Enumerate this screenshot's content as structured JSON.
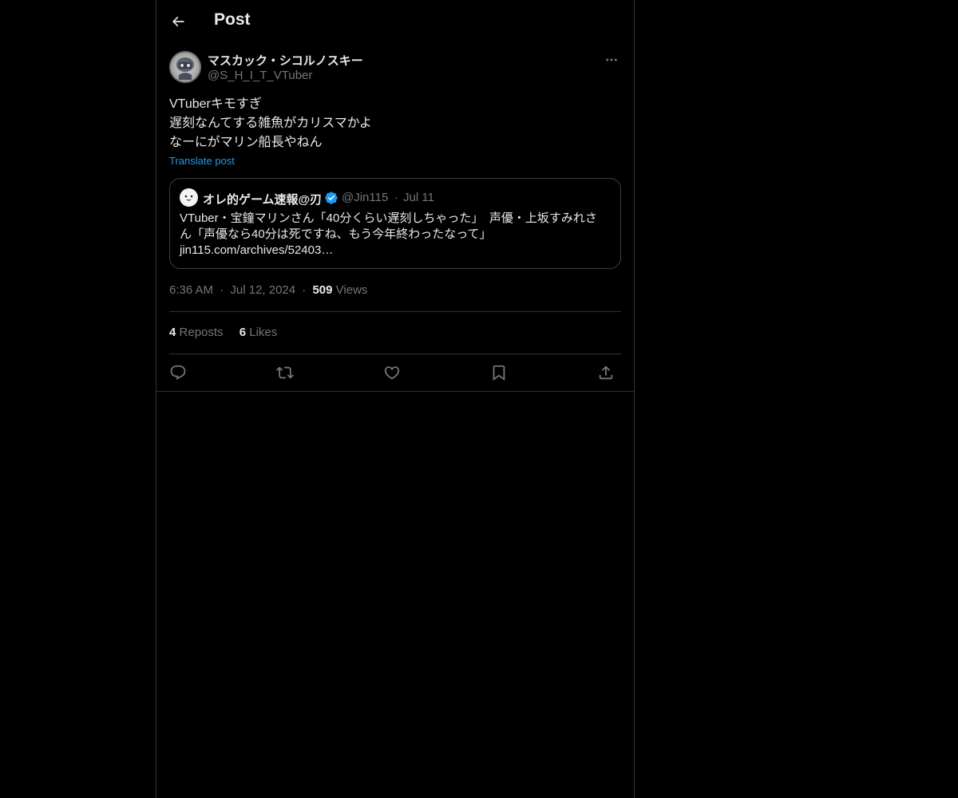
{
  "header": {
    "title": "Post"
  },
  "post": {
    "author": {
      "name": "マスカック・シコルノスキー",
      "handle": "@S_H_I_T_VTuber"
    },
    "text_lines": [
      "VTuberキモすぎ",
      "遅刻なんてする雑魚がカリスマかよ",
      "なーにがマリン船長やねん"
    ],
    "translate_label": "Translate post",
    "quote": {
      "name": "オレ的ゲーム速報@刃",
      "handle": "@Jin115",
      "separator": "·",
      "date": "Jul 11",
      "body_lines": [
        "VTuber・宝鐘マリンさん「40分くらい遅刻しちゃった」　声優・上坂すみれさ",
        "ん「声優なら40分は死ですね、もう今年終わったなって」",
        "jin115.com/archives/52403…"
      ]
    },
    "meta": {
      "time": "6:36 AM",
      "separator": "·",
      "date": "Jul 12, 2024",
      "views_count": "509",
      "views_label": "Views"
    },
    "stats": {
      "reposts_count": "4",
      "reposts_label": "Reposts",
      "likes_count": "6",
      "likes_label": "Likes"
    }
  },
  "colors": {
    "background": "#000000",
    "text": "#e7e9ea",
    "muted": "#71767b",
    "accent": "#1d9bf0",
    "border": "#2f3336"
  },
  "icons": {
    "back": "arrow-left-icon",
    "more": "more-horizontal-icon",
    "verified": "verified-badge-icon",
    "reply": "reply-icon",
    "repost": "repost-icon",
    "like": "heart-icon",
    "bookmark": "bookmark-icon",
    "share": "share-icon"
  }
}
